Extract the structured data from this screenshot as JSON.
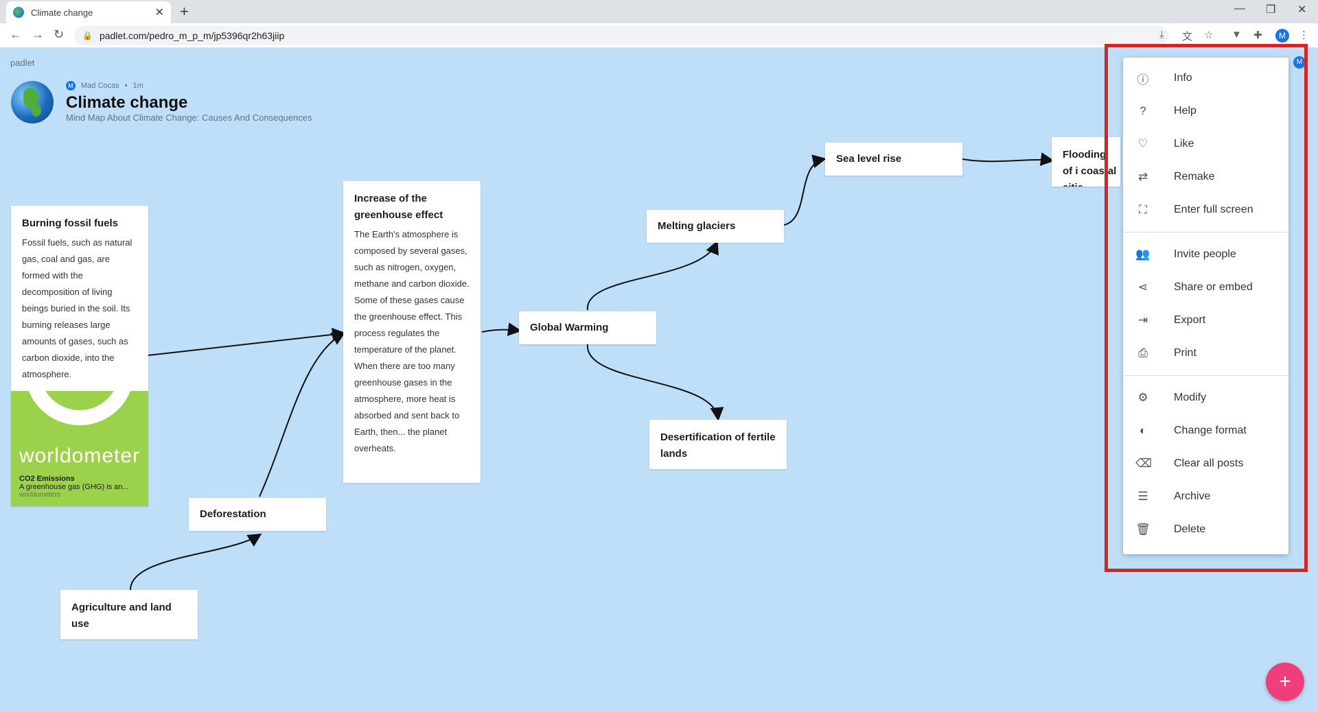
{
  "browser": {
    "tab_title": "Climate change",
    "url": "padlet.com/pedro_m_p_m/jp5396qr2h63jiip",
    "avatar_letter": "M"
  },
  "board": {
    "brand": "padlet",
    "author": "Mad Cocas",
    "author_initial": "M",
    "time_ago": "1m",
    "title": "Climate change",
    "subtitle": "Mind Map About Climate Change: Causes And Consequences"
  },
  "cards": {
    "burning": {
      "title": "Burning fossil fuels",
      "body": "Fossil fuels, such as natural gas, coal and gas, are formed with the decomposition of living beings buried in the soil. Its burning releases large amounts of gases, such as carbon dioxide, into the atmosphere.",
      "attachment_logo": "worldometer",
      "attachment_title": "CO2 Emissions",
      "attachment_desc": "A greenhouse gas (GHG) is an...",
      "attachment_source": "worldometers"
    },
    "greenhouse": {
      "title": "Increase of the greenhouse effect",
      "body": "The Earth's atmosphere is composed by several gases, such as nitrogen, oxygen, methane and carbon dioxide. Some of these gases cause the greenhouse effect. This process regulates the temperature of the planet. When there are too many greenhouse gases in the atmosphere, more heat is absorbed and sent back to Earth, then... the planet overheats."
    },
    "deforestation": {
      "title": "Deforestation"
    },
    "agriculture": {
      "title": "Agriculture and land use"
    },
    "global_warming": {
      "title": "Global Warming"
    },
    "melting": {
      "title": "Melting glaciers"
    },
    "sea_level": {
      "title": "Sea level rise"
    },
    "flooding": {
      "title": "Flooding of i coastal citie"
    },
    "desertification": {
      "title": "Desertification of fertile lands"
    }
  },
  "menu": {
    "items": [
      {
        "icon": "info-icon",
        "glyph": "ⓘ",
        "label": "Info"
      },
      {
        "icon": "help-icon",
        "glyph": "?",
        "label": "Help"
      },
      {
        "icon": "heart-icon",
        "glyph": "♡",
        "label": "Like"
      },
      {
        "icon": "remake-icon",
        "glyph": "⇄",
        "label": "Remake"
      },
      {
        "icon": "fullscreen-icon",
        "glyph": "⛶",
        "label": "Enter full screen"
      },
      {
        "icon": "invite-icon",
        "glyph": "👥",
        "label": "Invite people"
      },
      {
        "icon": "share-icon",
        "glyph": "⋖",
        "label": "Share or embed"
      },
      {
        "icon": "export-icon",
        "glyph": "⇥",
        "label": "Export"
      },
      {
        "icon": "print-icon",
        "glyph": "⎙",
        "label": "Print"
      },
      {
        "icon": "gear-icon",
        "glyph": "⚙",
        "label": "Modify"
      },
      {
        "icon": "format-icon",
        "glyph": "◐",
        "label": "Change format"
      },
      {
        "icon": "eraser-icon",
        "glyph": "⌫",
        "label": "Clear all posts"
      },
      {
        "icon": "archive-icon",
        "glyph": "☰",
        "label": "Archive"
      },
      {
        "icon": "trash-icon",
        "glyph": "🗑",
        "label": "Delete"
      }
    ]
  },
  "fab": {
    "glyph": "+"
  },
  "colors": {
    "highlight": "#d42426",
    "fab": "#ee3e7b",
    "background": "#bfdef8"
  }
}
